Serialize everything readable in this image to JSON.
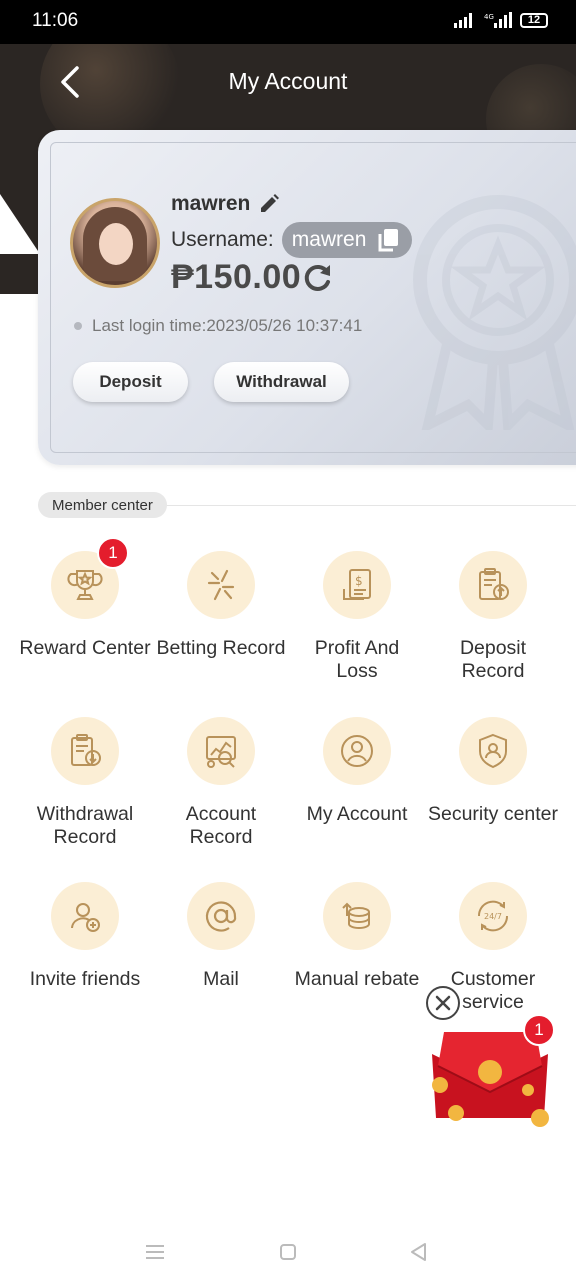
{
  "status_bar": {
    "time": "11:06",
    "battery": "12"
  },
  "header": {
    "title": "My Account"
  },
  "profile": {
    "nickname": "mawren",
    "username_label": "Username:",
    "username": "mawren",
    "balance": "₱150.00",
    "last_login": "Last login time:2023/05/26 10:37:41",
    "deposit_label": "Deposit",
    "withdrawal_label": "Withdrawal"
  },
  "member_center": {
    "title": "Member center",
    "items": [
      {
        "label": "Reward Center",
        "icon": "trophy-icon",
        "badge": "1"
      },
      {
        "label": "Betting Record",
        "icon": "sparkle-icon"
      },
      {
        "label": "Profit And\nLoss",
        "icon": "receipt-dollar-icon"
      },
      {
        "label": "Deposit\nRecord",
        "icon": "clipboard-upload-icon"
      },
      {
        "label": "Withdrawal\nRecord",
        "icon": "clipboard-download-icon"
      },
      {
        "label": "Account\nRecord",
        "icon": "chart-search-icon"
      },
      {
        "label": "My Account",
        "icon": "user-circle-icon"
      },
      {
        "label": "Security center",
        "icon": "shield-user-icon"
      },
      {
        "label": "Invite friends",
        "icon": "user-add-icon"
      },
      {
        "label": "Mail",
        "icon": "at-sign-icon"
      },
      {
        "label": "Manual rebate",
        "icon": "coins-icon"
      },
      {
        "label": "Customer\nservice",
        "icon": "support-247-icon"
      }
    ]
  },
  "red_packet": {
    "badge": "1"
  },
  "colors": {
    "accent_gold": "#c9a46a",
    "icon_bg": "#fbeed5",
    "badge_red": "#e41d2d",
    "header_bg": "#2b2623"
  }
}
